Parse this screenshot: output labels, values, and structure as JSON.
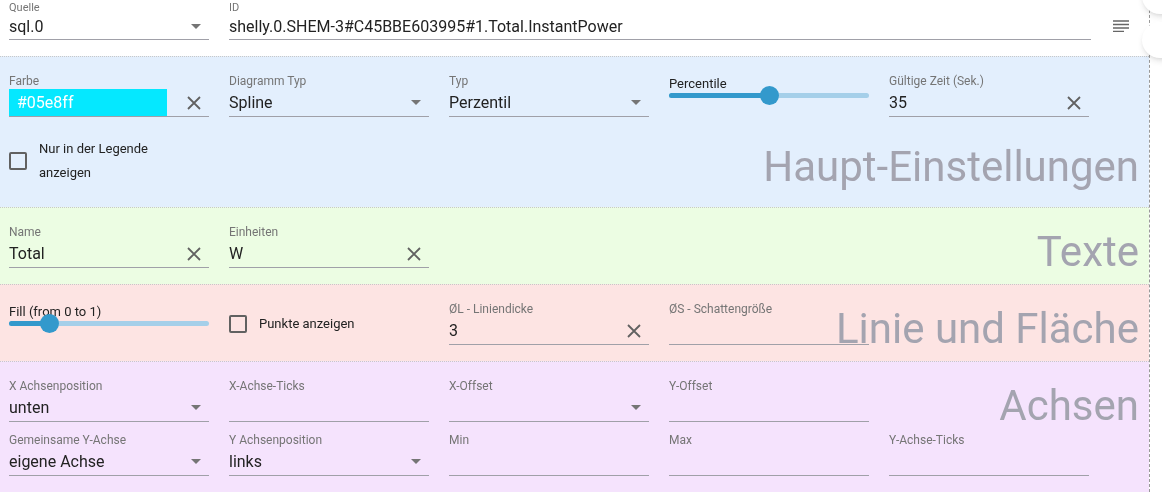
{
  "top": [
    {
      "kind": "select",
      "label": "Quelle",
      "value": "sql.0"
    },
    {
      "kind": "id",
      "label": "ID",
      "value": "shelly.0.SHEM-3#C45BBE603995#1.Total.InstantPower"
    }
  ],
  "sections": [
    {
      "title": "Haupt-Einstellungen",
      "color": "#e3effd",
      "rows": [
        [
          {
            "kind": "color",
            "label": "Farbe",
            "value": "#05e8ff",
            "clearable": true
          },
          {
            "kind": "select",
            "label": "Diagramm Typ",
            "value": "Spline"
          },
          {
            "kind": "select",
            "label": "Typ",
            "value": "Perzentil"
          },
          {
            "kind": "slider",
            "label": "Percentile",
            "level": 0.5
          },
          {
            "kind": "text",
            "label": "Gültige Zeit (Sek.)",
            "value": "35",
            "clearable": true
          }
        ],
        [
          {
            "kind": "checkbox",
            "label": "Nur in der Legende anzeigen",
            "checked": false
          }
        ]
      ]
    },
    {
      "title": "Texte",
      "color": "#ecfde3",
      "rows": [
        [
          {
            "kind": "text",
            "label": "Name",
            "value": "Total",
            "clearable": true
          },
          {
            "kind": "text",
            "label": "Einheiten",
            "value": "W",
            "clearable": true
          }
        ]
      ]
    },
    {
      "title": "Linie und Fläche",
      "color": "#fde4e3",
      "rows": [
        [
          {
            "kind": "slider",
            "label": "Fill (from 0 to 1)",
            "level": 0.2
          },
          {
            "kind": "checkbox",
            "label": "Punkte anzeigen",
            "checked": false
          },
          {
            "kind": "text",
            "label": "ØL - Liniendicke",
            "value": "3",
            "clearable": true
          },
          {
            "kind": "text",
            "label": "ØS - Schattengröße"
          }
        ]
      ]
    },
    {
      "title": "Achsen",
      "color": "#f5e3fd",
      "rows": [
        [
          {
            "kind": "select",
            "label": "X Achsenposition",
            "value": "unten"
          },
          {
            "kind": "text",
            "label": "X-Achse-Ticks"
          },
          {
            "kind": "select",
            "label": "X-Offset"
          },
          {
            "kind": "text",
            "label": "Y-Offset"
          }
        ],
        [
          {
            "kind": "select",
            "label": "Gemeinsame Y-Achse",
            "value": "eigene Achse"
          },
          {
            "kind": "select",
            "label": "Y Achsenposition",
            "value": "links"
          },
          {
            "kind": "text",
            "label": "Min"
          },
          {
            "kind": "text",
            "label": "Max"
          },
          {
            "kind": "text",
            "label": "Y-Achse-Ticks"
          }
        ]
      ]
    }
  ]
}
